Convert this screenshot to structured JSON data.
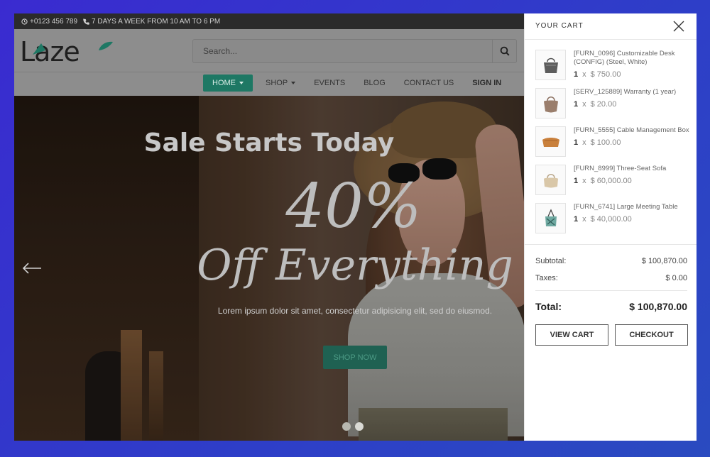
{
  "topbar": {
    "phone": "+0123 456 789",
    "hours": "7 DAYS A WEEK FROM 10 AM TO 6 PM"
  },
  "header": {
    "logo": "Laze",
    "search_placeholder": "Search..."
  },
  "nav": {
    "items": [
      {
        "label": "HOME"
      },
      {
        "label": "SHOP"
      },
      {
        "label": "EVENTS"
      },
      {
        "label": "BLOG"
      },
      {
        "label": "CONTACT US"
      },
      {
        "label": "SIGN IN"
      }
    ]
  },
  "hero": {
    "title": "Sale Starts Today",
    "percent": "40%",
    "off": "Off Everything",
    "subtitle": "Lorem ipsum dolor sit amet, consectetur adipisicing elit, sed do eiusmod.",
    "button": "SHOP NOW"
  },
  "cart": {
    "title": "YOUR CART",
    "items": [
      {
        "name": "[FURN_0096] Customizable Desk (CONFIG) (Steel, White)",
        "qty": "1",
        "x": "x",
        "price": "$ 750.00",
        "icon": "bag-gray-icon"
      },
      {
        "name": "[SERV_125889] Warranty (1 year)",
        "qty": "1",
        "x": "x",
        "price": "$ 20.00",
        "icon": "bag-taupe-icon"
      },
      {
        "name": "[FURN_5555] Cable Management Box",
        "qty": "1",
        "x": "x",
        "price": "$ 100.00",
        "icon": "bag-orange-icon"
      },
      {
        "name": "[FURN_8999] Three-Seat Sofa",
        "qty": "1",
        "x": "x",
        "price": "$ 60,000.00",
        "icon": "bag-beige-icon"
      },
      {
        "name": "[FURN_6741] Large Meeting Table",
        "qty": "1",
        "x": "x",
        "price": "$ 40,000.00",
        "icon": "bag-teal-icon"
      }
    ],
    "subtotal_label": "Subtotal:",
    "subtotal": "$ 100,870.00",
    "taxes_label": "Taxes:",
    "taxes": "$ 0.00",
    "total_label": "Total:",
    "total": "$ 100,870.00",
    "view_cart": "VIEW CART",
    "checkout": "CHECKOUT"
  },
  "colors": {
    "accent": "#1e7864",
    "background": "#3a2bd0"
  }
}
